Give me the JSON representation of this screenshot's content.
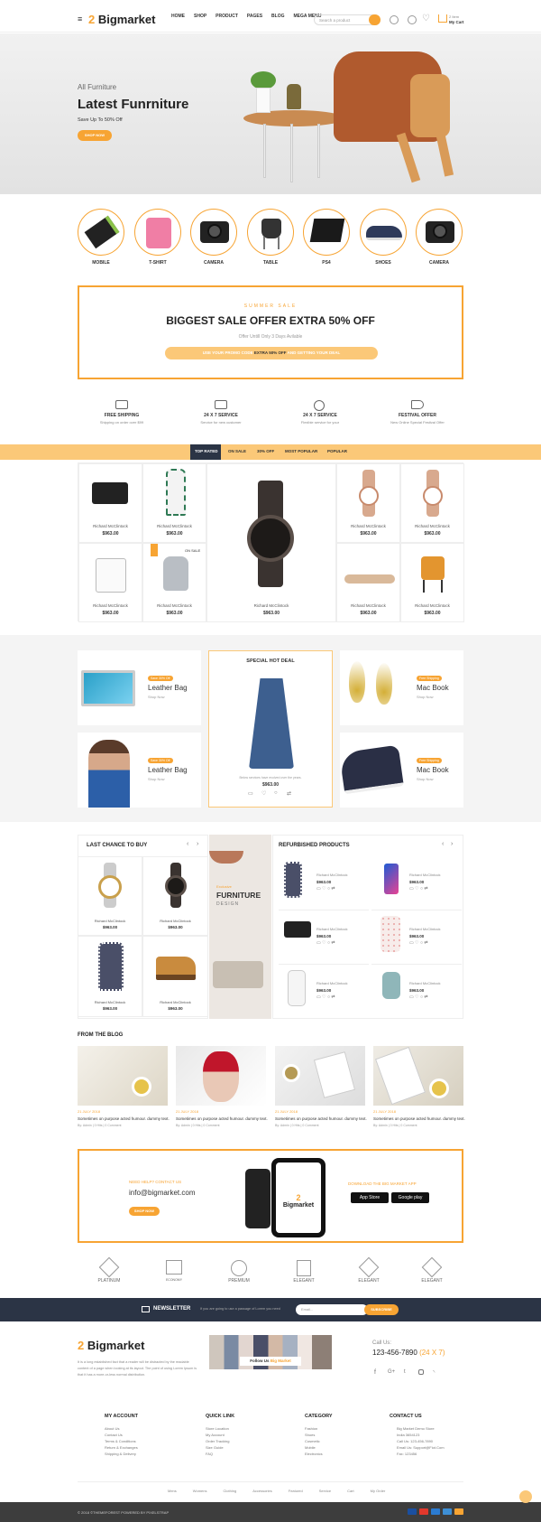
{
  "header": {
    "logo": "Bigmarket",
    "nav": [
      "HOME",
      "SHOP",
      "PRODUCT",
      "PAGES",
      "BLOG",
      "MEGA MENU"
    ],
    "search_placeholder": "Search a product",
    "cart_items": "2 Item",
    "cart_label": "My Cart"
  },
  "hero": {
    "kicker": "All Furniture",
    "title": "Latest Funrniture",
    "subtitle": "Save Up To 50% Off",
    "button": "SHOP NOW"
  },
  "categories": [
    "MOBILE",
    "T-SHIRT",
    "CAMERA",
    "TABLE",
    "PS4",
    "SHOES",
    "CAMERA"
  ],
  "promo": {
    "kicker": "SUMMER SALE",
    "title_a": "BIGGEST SALE OFFER ",
    "title_b": "EXTRA 50% OFF",
    "sub": "Offer Untill Only 3 Days Avilable",
    "bar_a": "USE YOUR PROMO CODE ",
    "bar_b": "EXTRA 50% OFF",
    "bar_c": " AND GETTING YOUR DEAL"
  },
  "services": [
    {
      "title": "FREE SHIPPING",
      "sub": "Shipping on order over $99"
    },
    {
      "title": "24 X 7 SERVICE",
      "sub": "Service for new customer"
    },
    {
      "title": "24 X 7 SERVICE",
      "sub": "Flexible service for your"
    },
    {
      "title": "FESTIVAL OFFER",
      "sub": "New Online Special Festival Offer"
    }
  ],
  "tabs": [
    "TOP RATED",
    "ON SALE",
    "30% OFF",
    "MOST POPULAR",
    "POPULAR"
  ],
  "product": {
    "name": "Richard McClintock",
    "price": "$963.00",
    "badge": "ON SALE"
  },
  "deals": {
    "tag1": "Save 30% Off",
    "leather": "Leather Bag",
    "shop_now": "Shop Now",
    "tag2": "Free Shipping",
    "macbook": "Mac Book",
    "special": "SPECIAL HOT DEAL",
    "special_text": "Below services have evolved over the years.",
    "special_price": "$963.00"
  },
  "last_chance": "LAST CHANCE TO BUY",
  "refurbished": "REFURBISHED PRODUCTS",
  "furniture_banner": {
    "kicker": "Exclusive",
    "title": "FURNITURE",
    "sub": "DESIGN"
  },
  "blog": {
    "title": "FROM THE BLOG",
    "posts": [
      {
        "date": "21 JULY 2018",
        "text": "Sometimes on purpose acted humour. dummy text.",
        "meta": "By: Admin | 0 Hits | 0 Comment"
      },
      {
        "date": "21 JULY 2018",
        "text": "Sometimes on purpose acted humour. dummy text.",
        "meta": "By: Admin | 0 Hits | 0 Comment"
      },
      {
        "date": "21 JULY 2018",
        "text": "Sometimes on purpose acted humour. dummy text.",
        "meta": "By: Admin | 0 Hits | 0 Comment"
      },
      {
        "date": "21 JULY 2018",
        "text": "Sometimes on purpose acted humour. dummy text.",
        "meta": "By: Admin | 0 Hits | 0 Comment"
      }
    ]
  },
  "app": {
    "need_help": "NEED HELP? CONTACT US",
    "email": "info@bigmarket.com",
    "button": "SHOP NOW",
    "download": "DOWNLOAD THE BIG MARKET APP",
    "app_store": "App Store",
    "google_play": "Google play",
    "phone_logo": "Bigmarket"
  },
  "brands": [
    "PLATINUM",
    "ECONOMY",
    "PREMIUM",
    "ELEGANT",
    "ELEGANT",
    "ELEGANT"
  ],
  "newsletter": {
    "title": "NEWSLETTER",
    "text": "If you are going to use a passage of Lorem you need",
    "placeholder": "Email...",
    "button": "SUBSCRIBE"
  },
  "footer": {
    "logo": "Bigmarket",
    "about": "It is a long established fact that a reader will be distracted by the readable content of a page when looking at its layout. The point of using Lorem Ipsum is that it has a more-or-less normal distribution.",
    "follow": "Follow Us",
    "follow_b": "Big Market",
    "call": "Call Us:",
    "phone": "123-456-7890",
    "hours": "(24 X 7)",
    "cols": [
      {
        "title": "MY ACCOUNT",
        "items": [
          "About Us",
          "Contact Us",
          "Terms & Conditions",
          "Return & Exchanges",
          "Shipping & Delivery"
        ]
      },
      {
        "title": "QUICK LINK",
        "items": [
          "Store Location",
          "My Account",
          "Order Tracking",
          "Size Guide",
          "FAQ"
        ]
      },
      {
        "title": "CATEGORY",
        "items": [
          "Fashion",
          "Shoes",
          "Cosmetic",
          "Mobile",
          "Electronics"
        ]
      },
      {
        "title": "CONTACT US",
        "items": [
          "Big Market Demo Store",
          "India 3654123",
          "Call Us: 123-456-7890",
          "Email Us: Support@Fiot.Com",
          "Fax: 123456"
        ]
      }
    ],
    "links": [
      "Mens",
      "Womens",
      "Clothing",
      "Accessories",
      "Featured",
      "Service",
      "Cart",
      "My Order"
    ],
    "copyright": "© 2018 ©THEMEFOREST POWERED BY PIXELSTRAP"
  }
}
